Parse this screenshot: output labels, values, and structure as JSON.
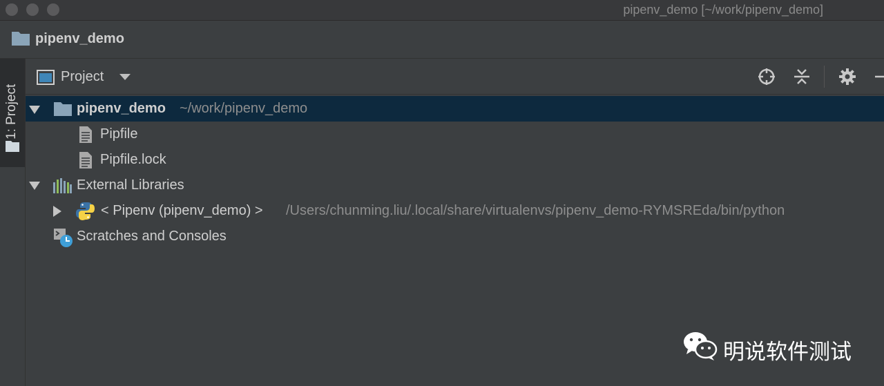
{
  "window": {
    "title": "pipenv_demo [~/work/pipenv_demo]"
  },
  "navbar": {
    "project_name": "pipenv_demo"
  },
  "tool_stripe": {
    "project_tab_label": "1: Project"
  },
  "panel": {
    "view_label": "Project",
    "actions": [
      "locate-icon",
      "collapse-all-icon",
      "gear-icon",
      "minimize-icon"
    ]
  },
  "tree": {
    "root": {
      "name": "pipenv_demo",
      "path": "~/work/pipenv_demo"
    },
    "files": [
      {
        "name": "Pipfile"
      },
      {
        "name": "Pipfile.lock"
      }
    ],
    "external_libraries": {
      "label": "External Libraries",
      "sdk_name": "< Pipenv (pipenv_demo) >",
      "sdk_path": "/Users/chunming.liu/.local/share/virtualenvs/pipenv_demo-RYMSREda/bin/python"
    },
    "scratches": {
      "label": "Scratches and Consoles"
    }
  },
  "watermark": {
    "text": "明说软件测试"
  },
  "colors": {
    "background": "#3c3f41",
    "selection": "#0d293e",
    "folder": "#8aa4b8",
    "python_blue": "#3a73a8",
    "python_yellow": "#f5d146"
  }
}
